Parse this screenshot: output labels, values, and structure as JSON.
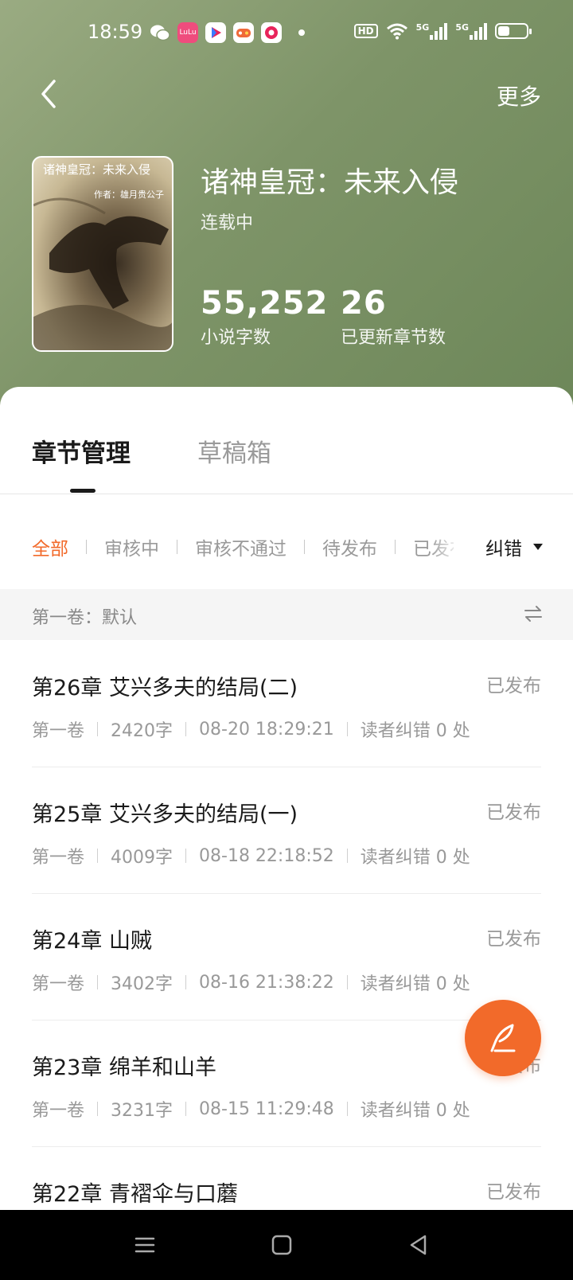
{
  "status_bar": {
    "time": "18:59",
    "apps": [
      {
        "icon": "wechat-icon",
        "color": "#ffffff"
      },
      {
        "icon": "lulu-app-icon",
        "color": "#ef4c7d",
        "text": "LuLu"
      },
      {
        "icon": "video-play-app-icon",
        "color": "#ffffff"
      },
      {
        "icon": "game-center-app-icon",
        "color": "#ffffff"
      },
      {
        "icon": "chat-app-icon",
        "color": "#ffffff"
      }
    ],
    "network_badge": "HD",
    "signal_label_1": "5G",
    "signal_label_2": "5G",
    "battery_level": 0.4
  },
  "top_bar": {
    "back_icon": "chevron-left-icon",
    "more_label": "更多"
  },
  "book": {
    "cover_title": "诸神皇冠：未来入侵",
    "cover_author": "作者：雄月贵公子",
    "title": "诸神皇冠：未来入侵",
    "status": "连载中",
    "word_count": "55,252",
    "word_count_label": "小说字数",
    "chapter_count": "26",
    "chapter_count_label": "已更新章节数"
  },
  "tabs": [
    {
      "label": "章节管理",
      "active": true
    },
    {
      "label": "草稿箱",
      "active": false
    }
  ],
  "filters": [
    {
      "label": "全部",
      "active": true
    },
    {
      "label": "审核中"
    },
    {
      "label": "审核不通过"
    },
    {
      "label": "待发布"
    },
    {
      "label": "已发布"
    }
  ],
  "correction_label": "纠错",
  "volume": {
    "label": "第一卷：默认",
    "swap_icon": "swap-icon"
  },
  "chapters": [
    {
      "title": "第26章 艾兴多夫的结局(二)",
      "state": "已发布",
      "volume": "第一卷",
      "words": "2420字",
      "time": "08-20 18:29:21",
      "corrections": "读者纠错 0 处"
    },
    {
      "title": "第25章 艾兴多夫的结局(一)",
      "state": "已发布",
      "volume": "第一卷",
      "words": "4009字",
      "time": "08-18 22:18:52",
      "corrections": "读者纠错 0 处"
    },
    {
      "title": "第24章 山贼",
      "state": "已发布",
      "volume": "第一卷",
      "words": "3402字",
      "time": "08-16 21:38:22",
      "corrections": "读者纠错 0 处"
    },
    {
      "title": "第23章 绵羊和山羊",
      "state": "已发布",
      "volume": "第一卷",
      "words": "3231字",
      "time": "08-15 11:29:48",
      "corrections": "读者纠错 0 处"
    },
    {
      "title": "第22章 青褶伞与口蘑",
      "state": "已发布"
    }
  ],
  "fab": {
    "icon": "quill-pen-icon",
    "color": "#f26a2a"
  },
  "nav_bar": {
    "menu_icon": "menu-icon",
    "home_icon": "home-square-icon",
    "back_icon": "back-triangle-icon"
  }
}
